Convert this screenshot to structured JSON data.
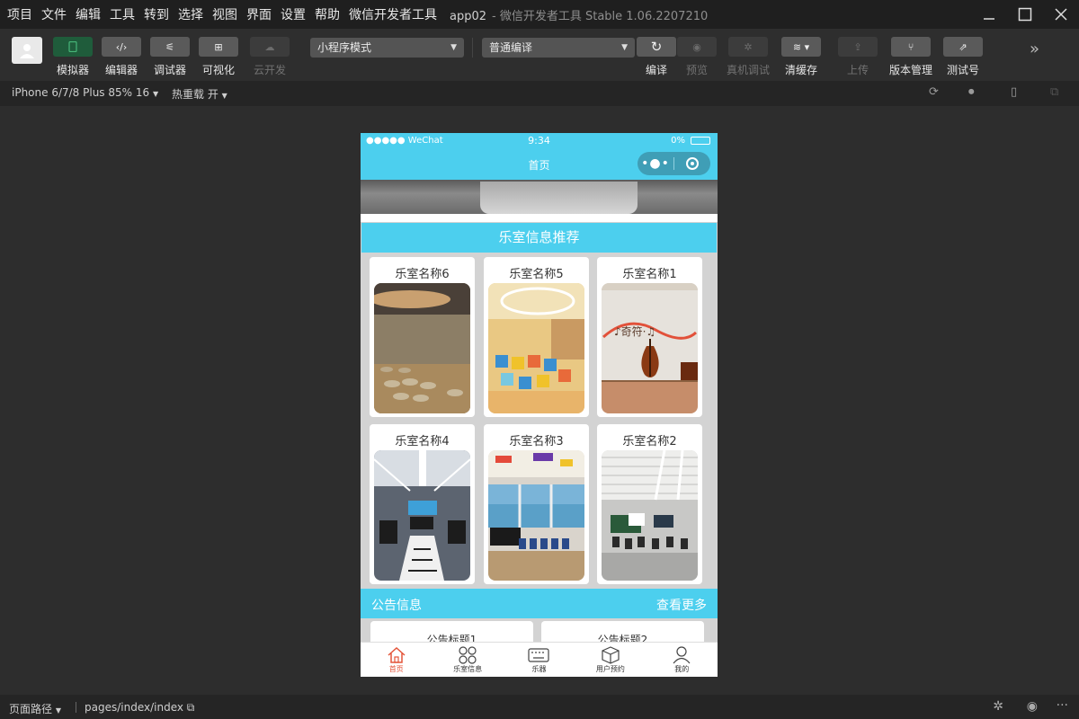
{
  "menu": [
    "项目",
    "文件",
    "编辑",
    "工具",
    "转到",
    "选择",
    "视图",
    "界面",
    "设置",
    "帮助",
    "微信开发者工具"
  ],
  "window": {
    "project": "app02",
    "title": "- 微信开发者工具 Stable 1.06.2207210"
  },
  "toolbar": {
    "left_tools": [
      {
        "label": "模拟器",
        "icon": "phone-icon"
      },
      {
        "label": "编辑器",
        "icon": "code-icon",
        "glyph": "‹/›"
      },
      {
        "label": "调试器",
        "icon": "sliders-icon",
        "glyph": "⚟"
      },
      {
        "label": "可视化",
        "icon": "layout-icon",
        "glyph": "⊞"
      },
      {
        "label": "云开发",
        "icon": "cloud-icon",
        "glyph": "☁"
      }
    ],
    "mode_select": "小程序模式",
    "compile_select": "普通编译",
    "right_tools": [
      {
        "label": "编译",
        "icon": "refresh-icon",
        "glyph": "↻"
      },
      {
        "label": "预览",
        "icon": "eye-icon",
        "glyph": "◉"
      },
      {
        "label": "真机调试",
        "icon": "bug-icon",
        "glyph": "✲"
      },
      {
        "label": "清缓存",
        "icon": "layers-icon",
        "glyph": "≋ ▾"
      },
      {
        "label": "上传",
        "icon": "upload-icon",
        "glyph": "⇪"
      },
      {
        "label": "版本管理",
        "icon": "branch-icon",
        "glyph": "⑂"
      },
      {
        "label": "测试号",
        "icon": "external-link-icon",
        "glyph": "⇗"
      }
    ],
    "more": "»"
  },
  "subbar": {
    "device": "iPhone 6/7/8 Plus 85% 16",
    "hotreload": "热重载 开"
  },
  "phone": {
    "status": {
      "carrier": "●●●●● WeChat",
      "time": "9:34",
      "battery": "0%"
    },
    "nav_title": "首页",
    "section_title": "乐室信息推荐",
    "rooms": [
      {
        "name": "乐室名称6"
      },
      {
        "name": "乐室名称5"
      },
      {
        "name": "乐室名称1"
      },
      {
        "name": "乐室名称4"
      },
      {
        "name": "乐室名称3"
      },
      {
        "name": "乐室名称2"
      }
    ],
    "notice_head": {
      "title": "公告信息",
      "more": "查看更多"
    },
    "notices": [
      "公告标题1",
      "公告标题2"
    ],
    "tabs": [
      {
        "label": "首页",
        "icon": "home-icon"
      },
      {
        "label": "乐室信息",
        "icon": "grid-icon"
      },
      {
        "label": "乐器",
        "icon": "keyboard-icon"
      },
      {
        "label": "用户预约",
        "icon": "box-icon"
      },
      {
        "label": "我的",
        "icon": "user-icon"
      }
    ]
  },
  "bottombar": {
    "label": "页面路径",
    "path": "pages/index/index"
  },
  "colors": {
    "accent": "#4ccfee",
    "active_tab": "#e4553a"
  }
}
